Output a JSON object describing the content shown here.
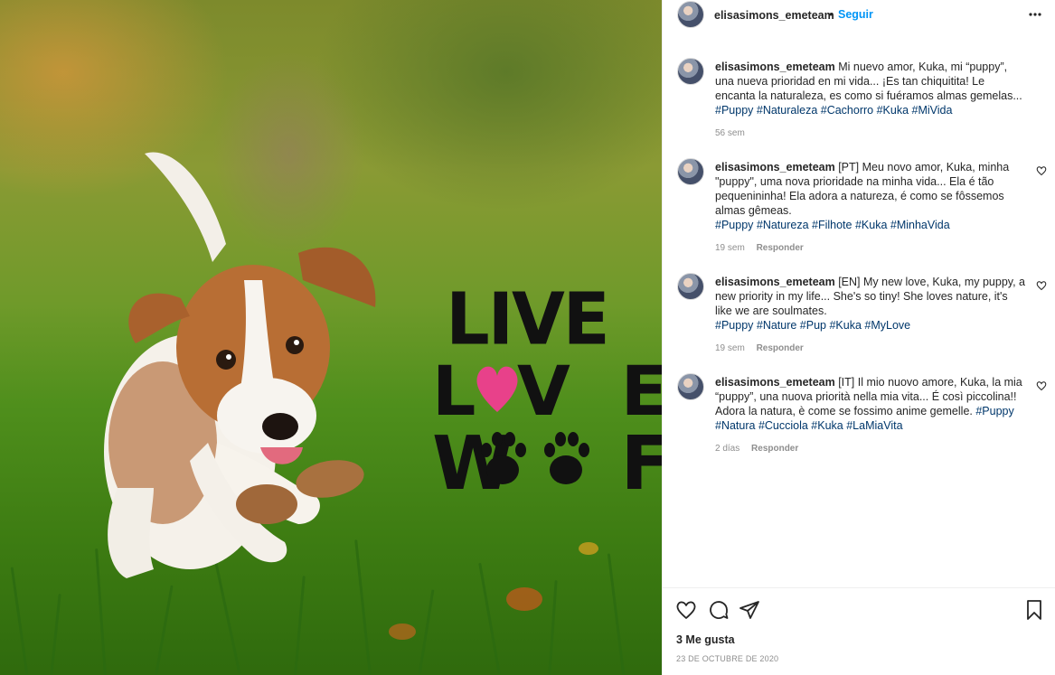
{
  "post": {
    "username": "elisasimons_emeteam",
    "separator": "•",
    "follow_label": "Seguir",
    "more_icon": "more-horizontal-icon"
  },
  "image": {
    "overlay": {
      "line1": "LIVE",
      "line2": "LVE",
      "line3": "WF"
    },
    "heart_color": "#e8418a"
  },
  "comments": [
    {
      "username": "elisasimons_emeteam",
      "text": "Mi nuevo amor, Kuka, mi “puppy”, una nueva prioridad en mi vida... ¡Es tan chiquitita! Le encanta la naturaleza, es como si fuéramos almas gemelas...",
      "tags": "#Puppy #Naturaleza #Cachorro #Kuka #MiVida",
      "time": "56 sem",
      "reply": ""
    },
    {
      "username": "elisasimons_emeteam",
      "text": "[PT] Meu novo amor, Kuka, minha \"puppy\", uma nova prioridade na minha vida... Ela é tão pequenininha! Ela adora a natureza, é como se fôssemos almas gêmeas.",
      "tags": "#Puppy #Natureza #Filhote #Kuka #MinhaVida",
      "time": "19 sem",
      "reply": "Responder"
    },
    {
      "username": "elisasimons_emeteam",
      "text": "[EN] My new love, Kuka, my puppy, a new priority in my life... She's so tiny! She loves nature, it's like we are soulmates.",
      "tags": "#Puppy #Nature #Pup #Kuka #MyLove",
      "time": "19 sem",
      "reply": "Responder"
    },
    {
      "username": "elisasimons_emeteam",
      "text": "[IT] Il mio nuovo amore, Kuka, la mia “puppy”, una nuova priorità nella mia vita... É così piccolina!! Adora la natura, è come se fossimo anime gemelle.",
      "tags": "#Puppy #Natura #Cucciola #Kuka #LaMiaVita",
      "time": "2 días",
      "reply": "Responder"
    }
  ],
  "footer": {
    "likes": "3 Me gusta",
    "date": "23 DE OCTUBRE DE 2020"
  },
  "colors": {
    "link_blue": "#0095f6",
    "hashtag": "#00376b",
    "muted": "#8e8e8e"
  }
}
